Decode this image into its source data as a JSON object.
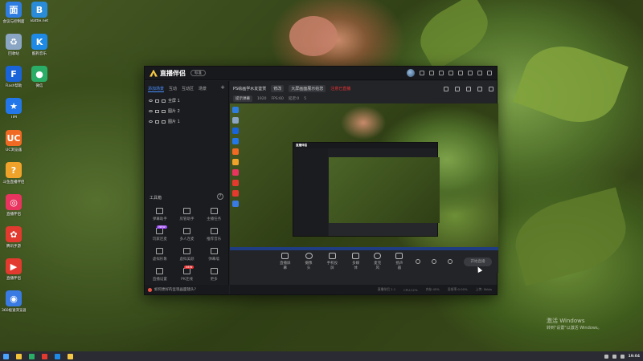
{
  "desktop": {
    "icons": [
      {
        "label": "会议与控制面",
        "color": "#2f7de1",
        "glyph": "面"
      },
      {
        "label": "Battle.net",
        "color": "#2a8bd8",
        "glyph": "B"
      },
      {
        "label": "回收站",
        "color": "#8aa6c4",
        "glyph": "♻"
      },
      {
        "label": "酷狗音乐",
        "color": "#1e8ae6",
        "glyph": "K"
      },
      {
        "label": "Flash帮助",
        "color": "#1a64d9",
        "glyph": "F"
      },
      {
        "label": "微信",
        "color": "#2aae67",
        "glyph": "●"
      },
      {
        "label": "TIM",
        "color": "#2377e8",
        "glyph": "★"
      },
      {
        "label": "UC浏览器",
        "color": "#f06a24",
        "glyph": "UC"
      },
      {
        "label": "斗鱼直播伴侣",
        "color": "#f0a32a",
        "glyph": "?"
      },
      {
        "label": "直播伴侣",
        "color": "#e8345f",
        "glyph": "◎"
      },
      {
        "label": "腾讯手游",
        "color": "#e33a2f",
        "glyph": "✿"
      },
      {
        "label": "直播伴侣",
        "color": "#e33a2f",
        "glyph": "▶"
      },
      {
        "label": "360极速浏览器",
        "color": "#3a7be3",
        "glyph": "◉"
      }
    ],
    "activation": {
      "line1": "激活 Windows",
      "line2": "转到\"设置\"以激活 Windows。"
    }
  },
  "app": {
    "title": "直播伴侣",
    "version_badge": "标准",
    "sidebar": {
      "tabs": [
        "添加场景",
        "互动",
        "互动区",
        "场景"
      ],
      "add": "+",
      "scenes": [
        "全屏 1",
        "图片 2",
        "图片 1"
      ],
      "tools_title": "工具箱",
      "tools_help": "?",
      "tools": [
        {
          "label": "弹幕助手",
          "badge": ""
        },
        {
          "label": "房管助手",
          "badge": ""
        },
        {
          "label": "主播任务",
          "badge": ""
        },
        {
          "label": "玩家连麦",
          "badge": "NEW"
        },
        {
          "label": "多人连麦",
          "badge": ""
        },
        {
          "label": "推荐音乐",
          "badge": ""
        },
        {
          "label": "虚拟形象",
          "badge": ""
        },
        {
          "label": "虚拟美颜",
          "badge": ""
        },
        {
          "label": "弹幕墙",
          "badge": ""
        },
        {
          "label": "直播设置",
          "badge": ""
        },
        {
          "label": "PK连线",
          "badge": "NEW"
        },
        {
          "label": "更多",
          "badge": ""
        }
      ],
      "bottom_tip": "如何更好的呈现画面镜头?"
    },
    "main": {
      "room_title": "PS绘画学水友鉴赏",
      "room_chip": "修改",
      "room_desc": "大屏画面展示给您",
      "warn": "注意已直播",
      "sub": [
        "提示弹幕",
        "1920",
        "FPS:60",
        "延迟:0",
        "5"
      ],
      "controls": [
        "直播屏幕",
        "摄像头",
        "手机投屏",
        "多媒体",
        "麦克风",
        "扬声器"
      ],
      "start_button": "开始直播"
    },
    "status": [
      "直播伴侣 2.1",
      "CPU:12%",
      "内存:45%",
      "丢帧率:0.00%",
      "上传: 0kb/s"
    ]
  },
  "taskbar": {
    "time": "19:04"
  }
}
